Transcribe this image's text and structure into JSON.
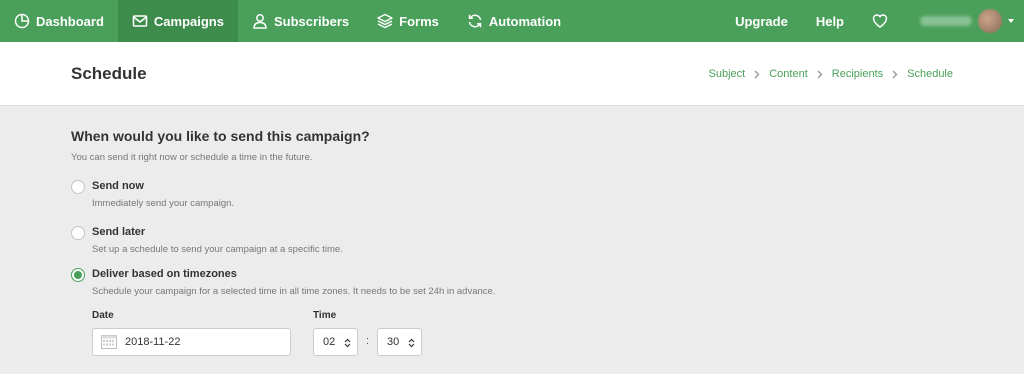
{
  "nav": {
    "items": [
      {
        "label": "Dashboard",
        "icon": "dashboard-icon"
      },
      {
        "label": "Campaigns",
        "icon": "envelope-icon",
        "active": true
      },
      {
        "label": "Subscribers",
        "icon": "user-icon"
      },
      {
        "label": "Forms",
        "icon": "layers-icon"
      },
      {
        "label": "Automation",
        "icon": "refresh-icon"
      }
    ],
    "upgrade": "Upgrade",
    "help": "Help",
    "favorite_icon": "heart-icon"
  },
  "colors": {
    "brand": "#4aa05a",
    "brand_dark": "#3d8c4c"
  },
  "header": {
    "title": "Schedule",
    "breadcrumb": [
      "Subject",
      "Content",
      "Recipients",
      "Schedule"
    ]
  },
  "schedule": {
    "question": "When would you like to send this campaign?",
    "subtext": "You can send it right now or schedule a time in the future.",
    "options": [
      {
        "label": "Send now",
        "description": "Immediately send your campaign.",
        "checked": false
      },
      {
        "label": "Send later",
        "description": "Set up a schedule to send your campaign at a specific time.",
        "checked": false
      },
      {
        "label": "Deliver based on timezones",
        "description": "Schedule your campaign for a selected time in all time zones. It needs to be set 24h in advance.",
        "checked": true
      }
    ],
    "date_label": "Date",
    "date_value": "2018-11-22",
    "time_label": "Time",
    "hour": "02",
    "minute": "30",
    "separator": ":"
  }
}
